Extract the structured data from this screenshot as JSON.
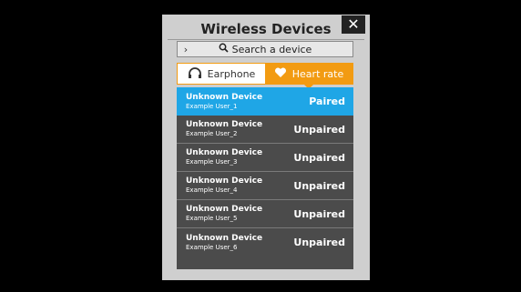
{
  "dialog": {
    "title": "Wireless Devices",
    "close_label": "✕"
  },
  "search": {
    "chevron": "›",
    "label": "Search a device"
  },
  "tabs": [
    {
      "label": "Earphone",
      "icon": "headphones-icon",
      "active": false
    },
    {
      "label": "Heart rate",
      "icon": "heart-icon",
      "active": true
    }
  ],
  "devices": [
    {
      "name": "Unknown Device",
      "user": "Example User_1",
      "status": "Paired"
    },
    {
      "name": "Unknown Device",
      "user": "Example User_2",
      "status": "Unpaired"
    },
    {
      "name": "Unknown Device",
      "user": "Example User_3",
      "status": "Unpaired"
    },
    {
      "name": "Unknown Device",
      "user": "Example User_4",
      "status": "Unpaired"
    },
    {
      "name": "Unknown Device",
      "user": "Example User_5",
      "status": "Unpaired"
    },
    {
      "name": "Unknown Device",
      "user": "Example User_6",
      "status": "Unpaired"
    }
  ],
  "colors": {
    "accent_orange": "#f29b12",
    "paired_blue": "#1fa6e6",
    "list_bg": "#4b4b4b"
  }
}
